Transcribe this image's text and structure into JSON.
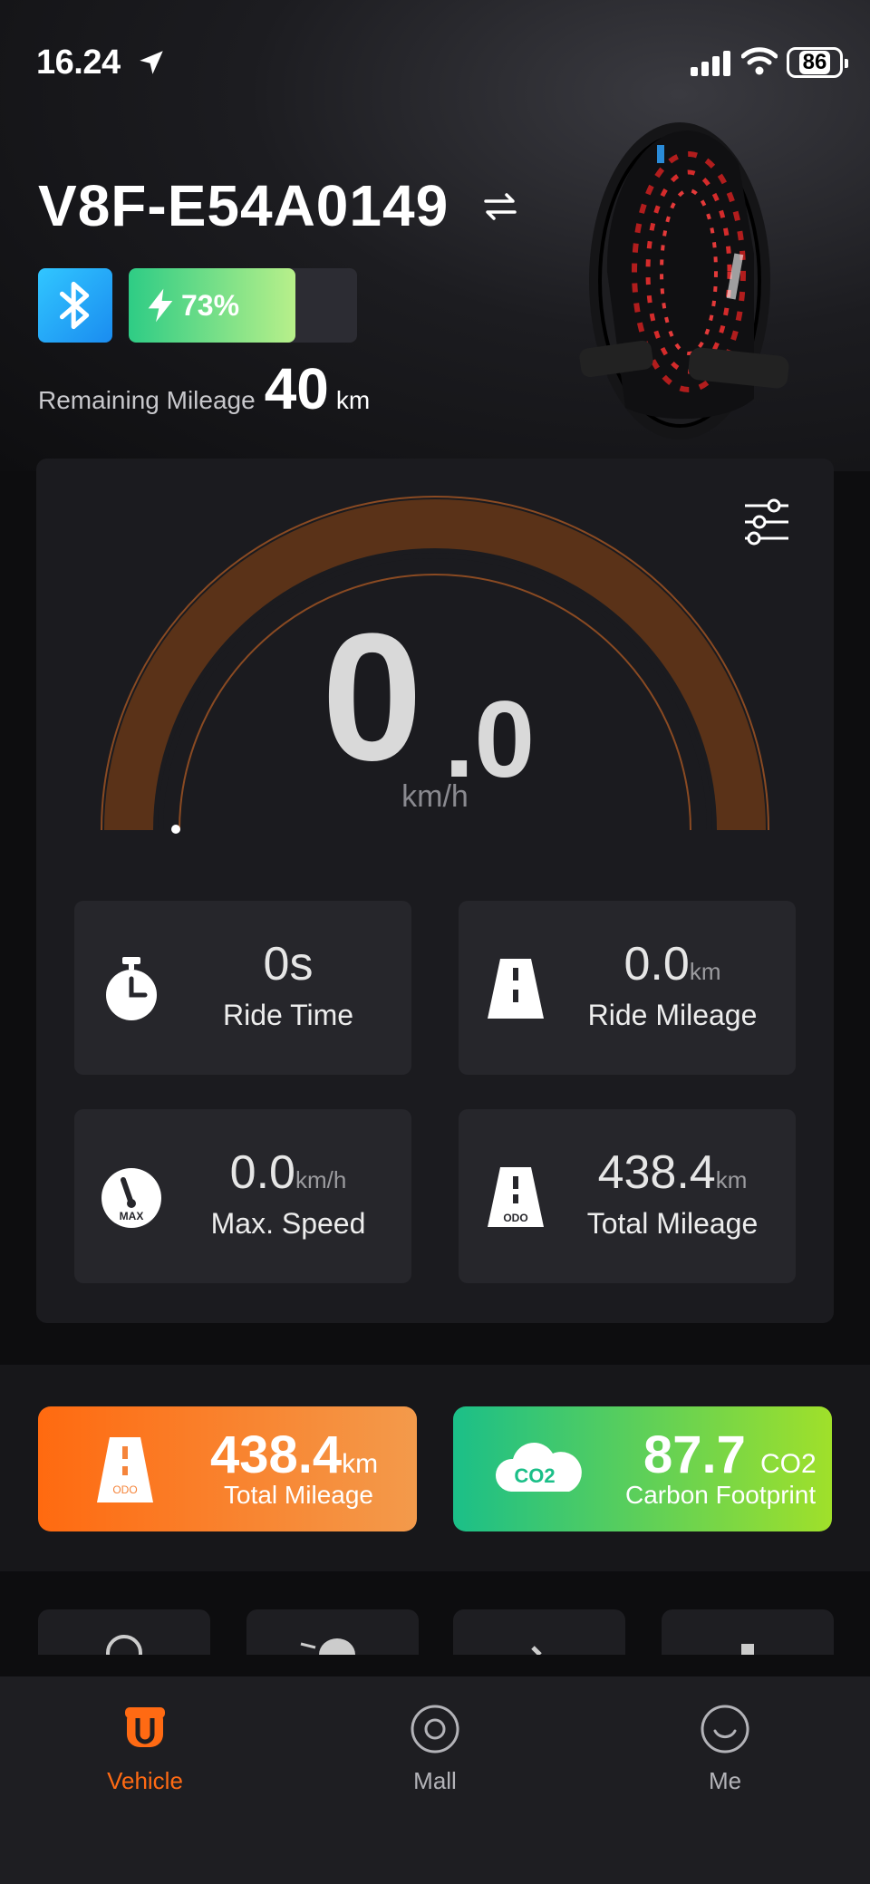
{
  "status_bar": {
    "time": "16.24",
    "battery": "86"
  },
  "vehicle": {
    "name": "V8F-E54A0149",
    "battery_percent_label": "73%",
    "battery_fraction": 0.73,
    "remaining_mileage_label": "Remaining Mileage",
    "remaining_mileage_value": "40",
    "remaining_mileage_unit": "km"
  },
  "speedometer": {
    "integer": "0",
    "decimal": ".0",
    "unit": "km/h"
  },
  "stats": [
    {
      "value": "0s",
      "unit": "",
      "label": "Ride Time",
      "icon": "stopwatch-icon"
    },
    {
      "value": "0.0",
      "unit": "km",
      "label": "Ride Mileage",
      "icon": "road-icon"
    },
    {
      "value": "0.0",
      "unit": "km/h",
      "label": "Max. Speed",
      "icon": "max-speed-gauge-icon",
      "icon_text": "MAX"
    },
    {
      "value": "438.4",
      "unit": "km",
      "label": "Total Mileage",
      "icon": "odometer-road-icon",
      "icon_text": "ODO"
    }
  ],
  "summary": {
    "total_mileage": {
      "value": "438.4",
      "unit": "km",
      "label": "Total Mileage",
      "icon_text": "ODO"
    },
    "carbon": {
      "value": "87.7",
      "unit": "CO2",
      "label": "Carbon Footprint",
      "icon_text": "CO2"
    }
  },
  "tabs": [
    {
      "label": "Vehicle",
      "icon": "vehicle-icon",
      "active": true
    },
    {
      "label": "Mall",
      "icon": "mall-icon",
      "active": false
    },
    {
      "label": "Me",
      "icon": "me-icon",
      "active": false
    }
  ],
  "colors": {
    "accent": "#ff6a13",
    "gauge_fill": "#5a3218",
    "battery_green": "#2ecc85",
    "carbon_green": "#1bbf88"
  }
}
